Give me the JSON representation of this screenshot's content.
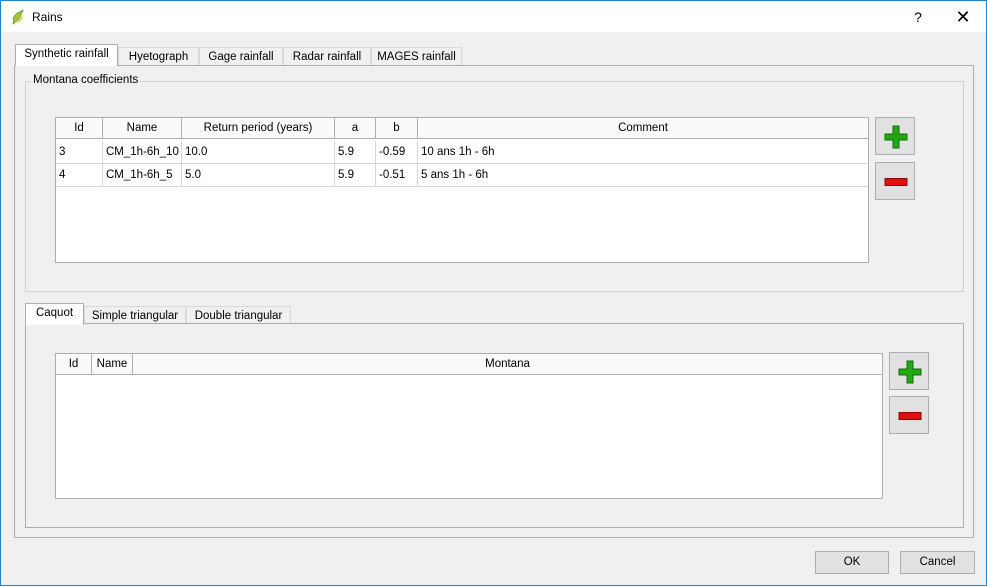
{
  "window": {
    "title": "Rains",
    "help_label": "?",
    "close_label": "✕"
  },
  "main_tabs": [
    {
      "label": "Synthetic rainfall",
      "active": true
    },
    {
      "label": "Hyetograph",
      "active": false
    },
    {
      "label": "Gage rainfall",
      "active": false
    },
    {
      "label": "Radar rainfall",
      "active": false
    },
    {
      "label": "MAGES rainfall",
      "active": false
    }
  ],
  "montana": {
    "group_title": "Montana coefficients",
    "columns": [
      "Id",
      "Name",
      "Return period (years)",
      "a",
      "b",
      "Comment"
    ],
    "rows": [
      [
        "3",
        "CM_1h-6h_10",
        "10.0",
        "5.9",
        "-0.59",
        "10 ans 1h - 6h"
      ],
      [
        "4",
        "CM_1h-6h_5",
        "5.0",
        "5.9",
        "-0.51",
        "5 ans 1h - 6h"
      ]
    ]
  },
  "sub_tabs": [
    {
      "label": "Caquot",
      "active": true
    },
    {
      "label": "Simple triangular",
      "active": false
    },
    {
      "label": "Double triangular",
      "active": false
    }
  ],
  "caquot": {
    "columns": [
      "Id",
      "Name",
      "Montana"
    ],
    "rows": []
  },
  "buttons": {
    "ok": "OK",
    "cancel": "Cancel"
  },
  "icons": {
    "add": "plus-icon",
    "remove": "minus-icon",
    "add_color": "#22a614",
    "remove_color": "#e01010"
  }
}
